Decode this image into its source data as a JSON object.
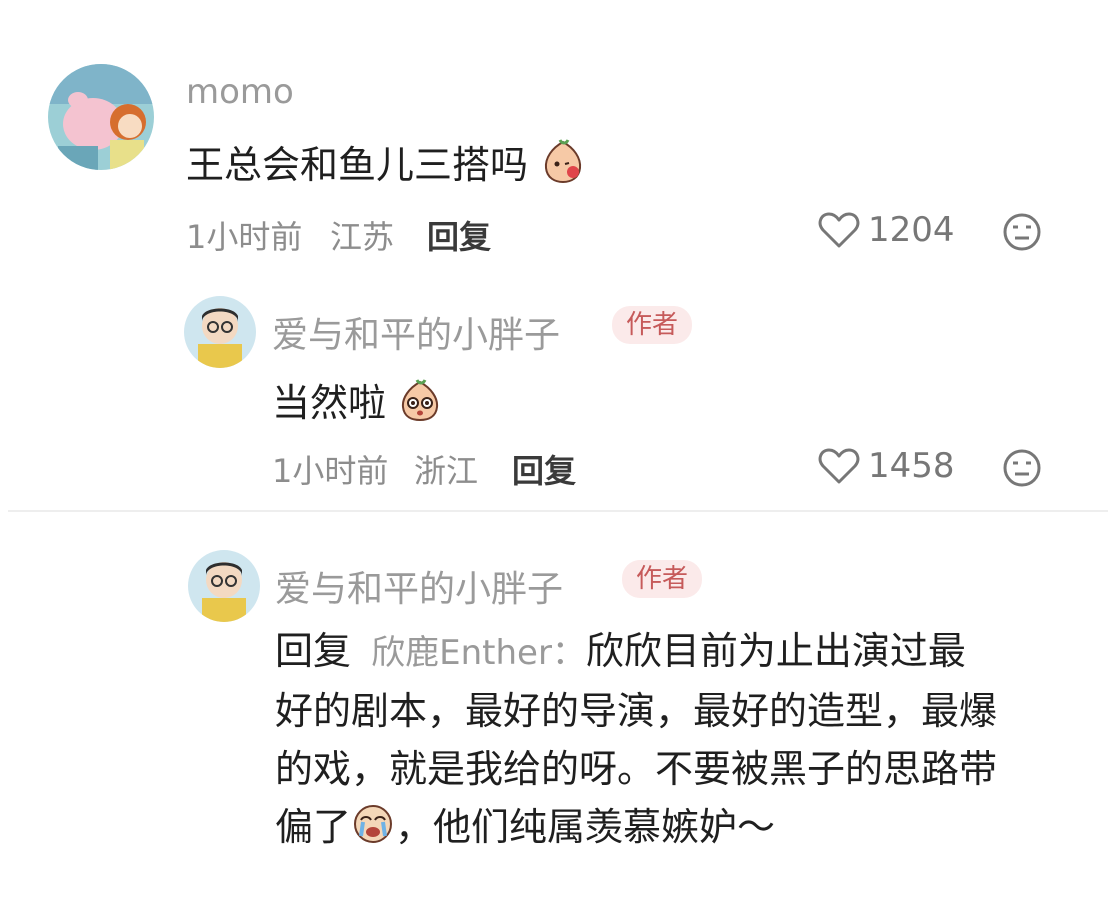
{
  "comments": [
    {
      "username": "momo",
      "content": "王总会和鱼儿三搭吗",
      "time": "1小时前",
      "location": "江苏",
      "reply_label": "回复",
      "likes": "1204",
      "is_author": false
    },
    {
      "username": "爱与和平的小胖子",
      "tag": "作者",
      "content": "当然啦",
      "time": "1小时前",
      "location": "浙江",
      "reply_label": "回复",
      "likes": "1458",
      "is_author": true
    },
    {
      "username": "爱与和平的小胖子",
      "tag": "作者",
      "reply_prefix": "回复",
      "reply_to": "欣鹿Enther：",
      "line1": "欣欣目前为止出演过最",
      "line2": "好的剧本，最好的导演，最好的造型，最爆",
      "line3": "的戏，就是我给的呀。不要被黑子的思路带",
      "line4a": "偏了",
      "line4b": "，他们纯属羡慕嫉妒～",
      "is_author": true
    }
  ],
  "icons": {
    "like": "heart-outline-icon",
    "dislike": "neutral-face-icon",
    "emoji1": "blush-peach-emoji",
    "emoji2": "surprised-peach-emoji",
    "emoji3": "crying-face-emoji"
  },
  "colors": {
    "tag_bg": "#fbeaea",
    "tag_text": "#c65a5a",
    "username": "#9a9a9a",
    "meta": "#8d8d8d"
  }
}
